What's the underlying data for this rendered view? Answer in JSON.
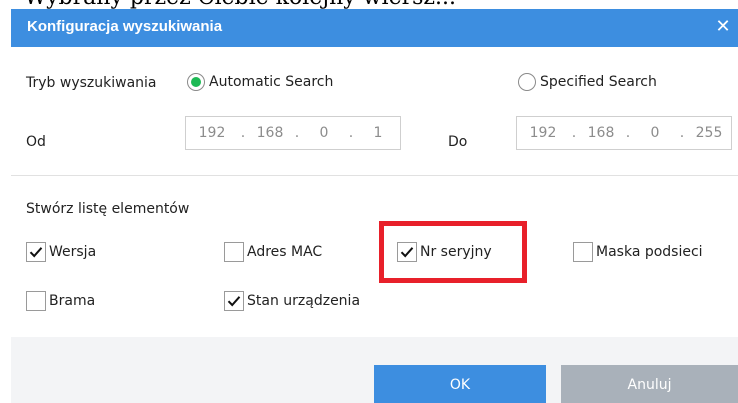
{
  "overlay_text": "Wybrany przez Ciebie kolejny wiersz...",
  "dialog": {
    "title": "Konfiguracja wyszukiwania",
    "close_glyph": "✕"
  },
  "search_mode": {
    "label": "Tryb wyszukiwania",
    "options": [
      {
        "label": "Automatic Search",
        "selected": true
      },
      {
        "label": "Specified Search",
        "selected": false
      }
    ]
  },
  "range": {
    "from_label": "Od",
    "to_label": "Do",
    "from_ip": [
      "192",
      "168",
      "0",
      "1"
    ],
    "to_ip": [
      "192",
      "168",
      "0",
      "255"
    ]
  },
  "list_section": {
    "title": "Stwórz listę elementów",
    "items": [
      {
        "label": "Wersja",
        "checked": true
      },
      {
        "label": "Adres MAC",
        "checked": false
      },
      {
        "label": "Nr seryjny",
        "checked": true
      },
      {
        "label": "Maska podsieci",
        "checked": false
      },
      {
        "label": "Brama",
        "checked": false
      },
      {
        "label": "Stan urządzenia",
        "checked": true
      }
    ]
  },
  "buttons": {
    "ok": "OK",
    "cancel": "Anuluj"
  },
  "colors": {
    "accent": "#3d8ee0",
    "radio_selected": "#1db954",
    "highlight": "#e8202a",
    "cancel_button": "#a9b1ba",
    "footer": "#f3f4f6"
  },
  "icons": {
    "close": "close-icon",
    "check": "checkmark-icon"
  }
}
